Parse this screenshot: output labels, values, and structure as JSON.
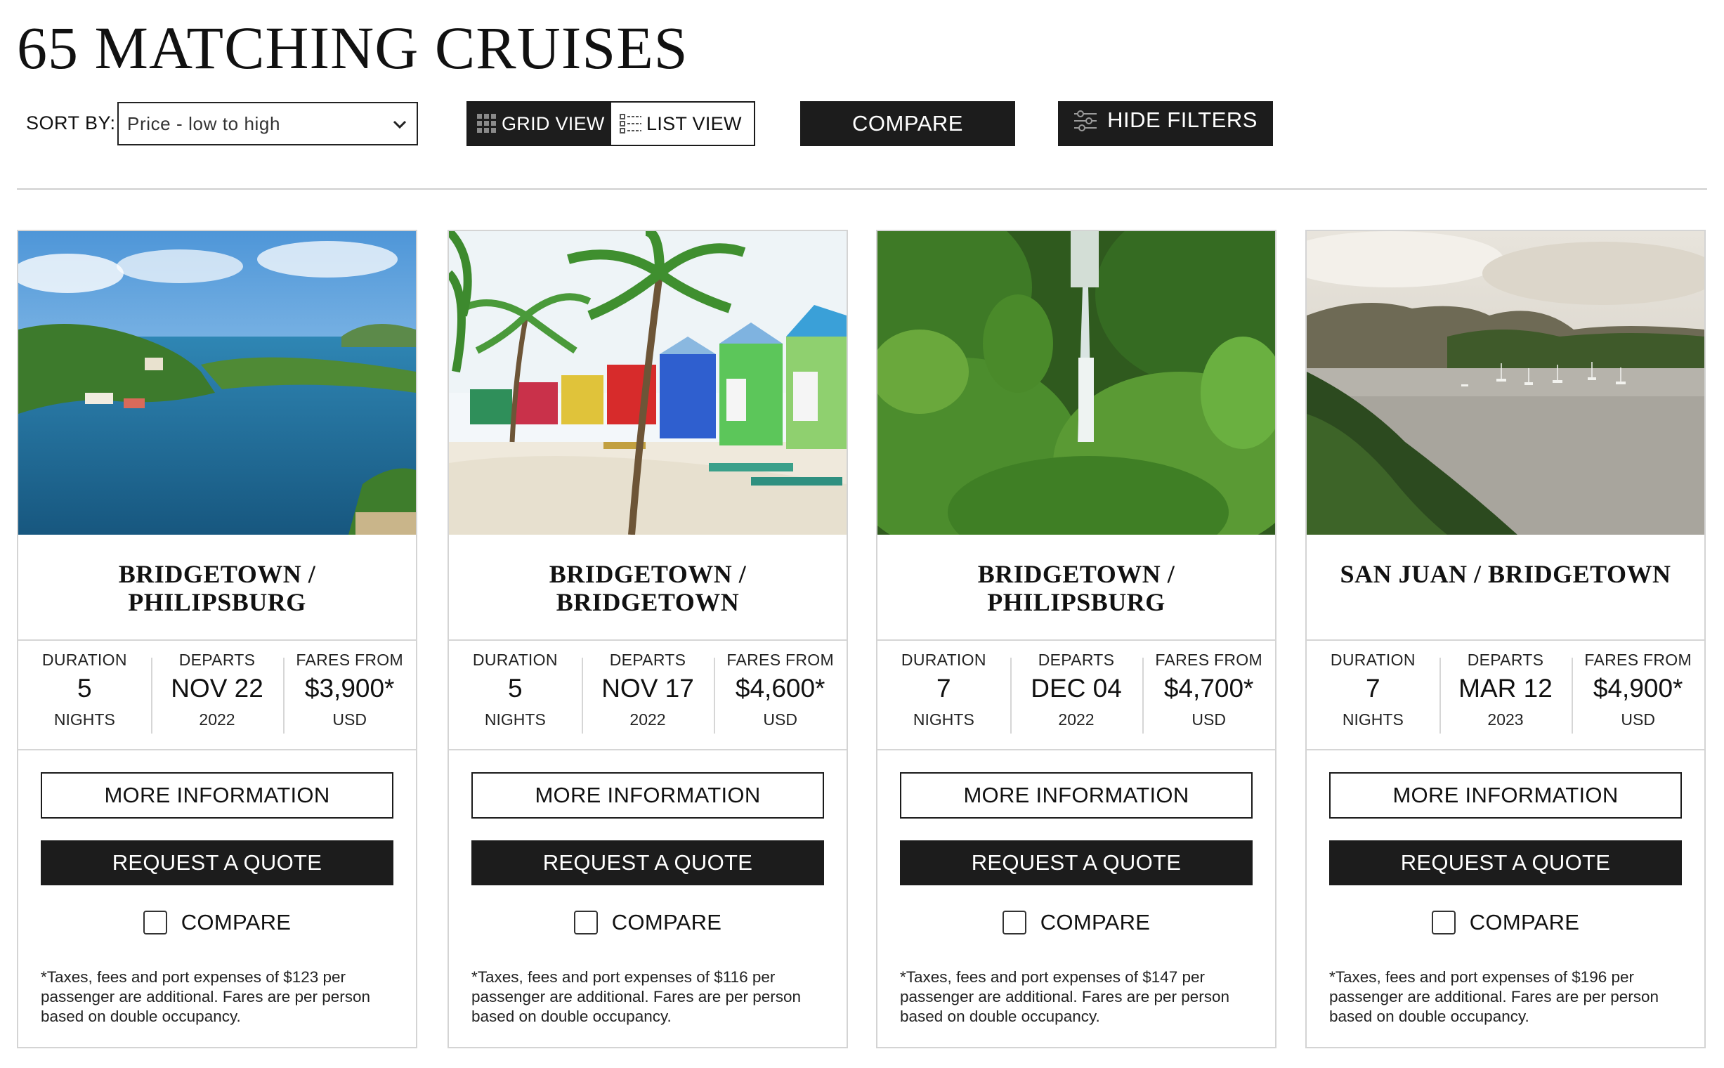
{
  "page": {
    "title": "65 MATCHING CRUISES"
  },
  "toolbar": {
    "sort_label": "SORT BY:",
    "sort_value": "Price - low to high",
    "grid_view_label": "GRID VIEW",
    "list_view_label": "LIST VIEW",
    "compare_label": "COMPARE",
    "hide_filters_label": "HIDE FILTERS",
    "active_view": "grid"
  },
  "labels": {
    "duration": "DURATION",
    "departs": "DEPARTS",
    "fares_from": "FARES FROM",
    "nights": "NIGHTS",
    "currency": "USD",
    "more_info": "MORE INFORMATION",
    "request_quote": "REQUEST A QUOTE",
    "compare": "COMPARE"
  },
  "cruises": [
    {
      "title_line1": "BRIDGETOWN /",
      "title_line2": "PHILIPSBURG",
      "duration": "5",
      "departs": "NOV 22",
      "year": "2022",
      "fare": "$3,900*",
      "disclaimer": "*Taxes, fees and port expenses of $123 per passenger are additional. Fares are per person based on double occupancy."
    },
    {
      "title_line1": "BRIDGETOWN /",
      "title_line2": "BRIDGETOWN",
      "duration": "5",
      "departs": "NOV 17",
      "year": "2022",
      "fare": "$4,600*",
      "disclaimer": "*Taxes, fees and port expenses of $116 per passenger are additional. Fares are per person based on double occupancy."
    },
    {
      "title_line1": "BRIDGETOWN /",
      "title_line2": "PHILIPSBURG",
      "duration": "7",
      "departs": "DEC 04",
      "year": "2022",
      "fare": "$4,700*",
      "disclaimer": "*Taxes, fees and port expenses of $147 per passenger are additional. Fares are per person based on double occupancy."
    },
    {
      "title_line1": "SAN JUAN / BRIDGETOWN",
      "title_line2": "",
      "duration": "7",
      "departs": "MAR 12",
      "year": "2023",
      "fare": "$4,900*",
      "disclaimer": "*Taxes, fees and port expenses of $196 per passenger are additional. Fares are per person based on double occupancy."
    }
  ],
  "colors": {
    "button_dark": "#1c1c1c",
    "border": "#d4d4d4"
  }
}
